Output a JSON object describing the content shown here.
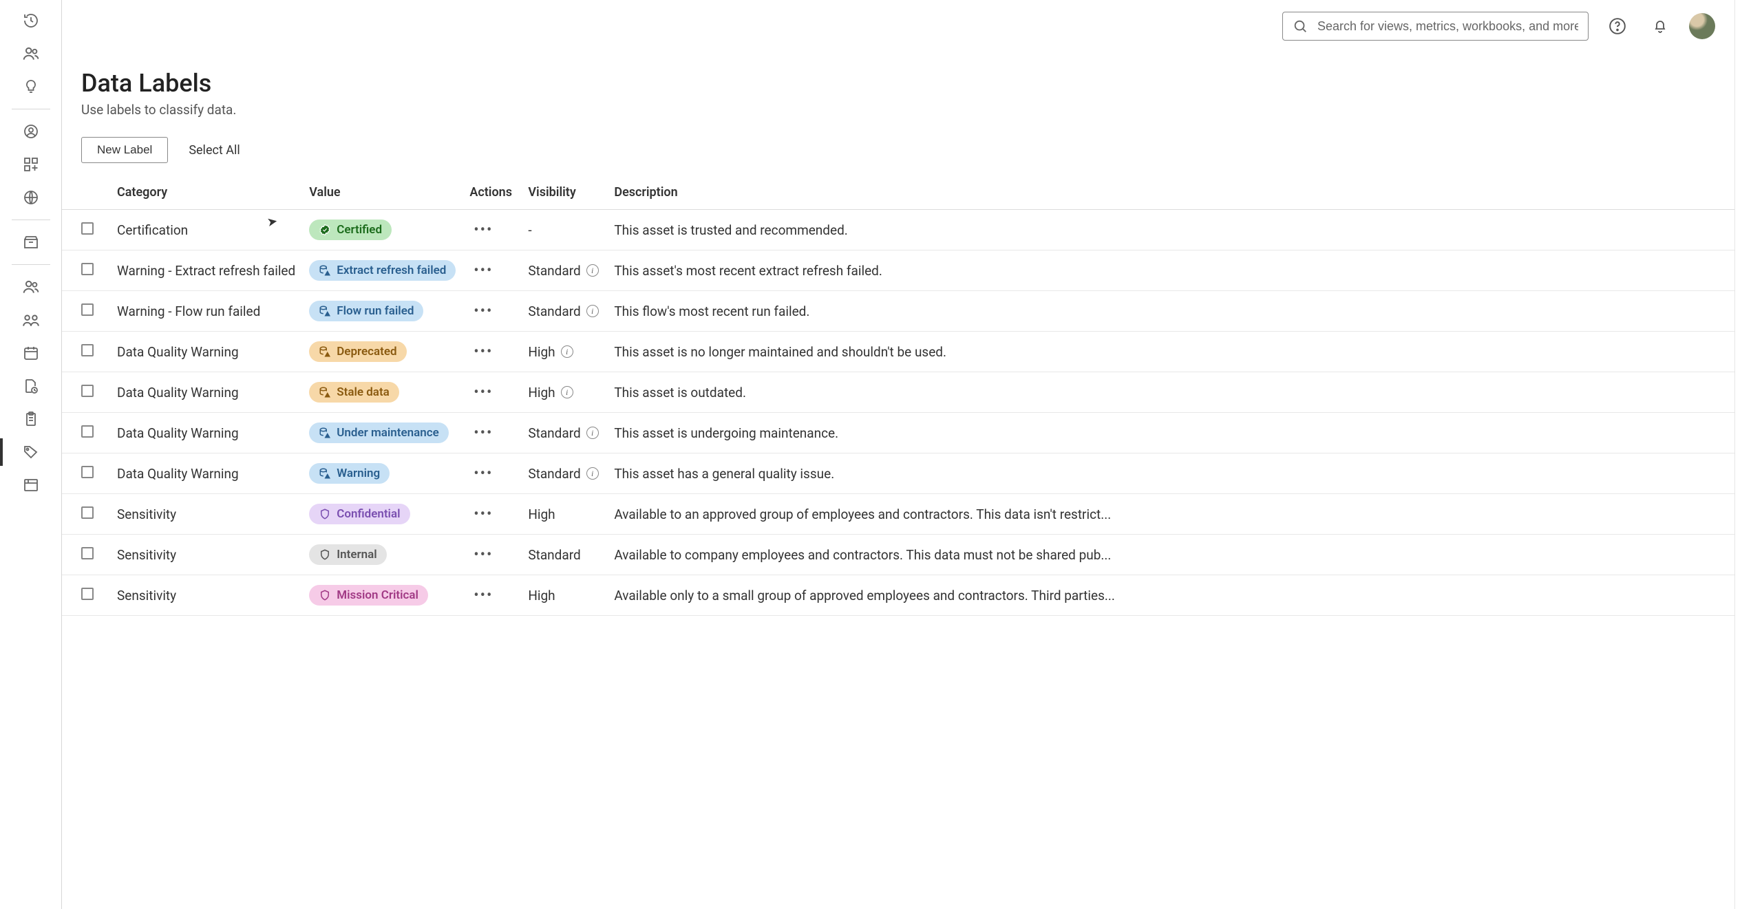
{
  "header": {
    "search_placeholder": "Search for views, metrics, workbooks, and more"
  },
  "page": {
    "title": "Data Labels",
    "subtitle": "Use labels to classify data.",
    "new_label_btn": "New Label",
    "select_all_btn": "Select All"
  },
  "columns": {
    "category": "Category",
    "value": "Value",
    "actions": "Actions",
    "visibility": "Visibility",
    "description": "Description"
  },
  "rows": [
    {
      "category": "Certification",
      "value": "Certified",
      "pill": "green",
      "icon": "cert",
      "visibility": "-",
      "info": false,
      "description": "This asset is trusted and recommended."
    },
    {
      "category": "Warning - Extract refresh failed",
      "value": "Extract refresh failed",
      "pill": "blue",
      "icon": "warn-db",
      "visibility": "Standard",
      "info": true,
      "description": "This asset's most recent extract refresh failed."
    },
    {
      "category": "Warning - Flow run failed",
      "value": "Flow run failed",
      "pill": "blue",
      "icon": "warn-db",
      "visibility": "Standard",
      "info": true,
      "description": "This flow's most recent run failed."
    },
    {
      "category": "Data Quality Warning",
      "value": "Deprecated",
      "pill": "orange",
      "icon": "warn-db",
      "visibility": "High",
      "info": true,
      "description": "This asset is no longer maintained and shouldn't be used."
    },
    {
      "category": "Data Quality Warning",
      "value": "Stale data",
      "pill": "orange",
      "icon": "warn-db",
      "visibility": "High",
      "info": true,
      "description": "This asset is outdated."
    },
    {
      "category": "Data Quality Warning",
      "value": "Under maintenance",
      "pill": "blue",
      "icon": "warn-db",
      "visibility": "Standard",
      "info": true,
      "description": "This asset is undergoing maintenance."
    },
    {
      "category": "Data Quality Warning",
      "value": "Warning",
      "pill": "blue",
      "icon": "warn-db",
      "visibility": "Standard",
      "info": true,
      "description": "This asset has a general quality issue."
    },
    {
      "category": "Sensitivity",
      "value": "Confidential",
      "pill": "purple",
      "icon": "shield",
      "visibility": "High",
      "info": false,
      "description": "Available to an approved group of employees and contractors. This data isn't restrict..."
    },
    {
      "category": "Sensitivity",
      "value": "Internal",
      "pill": "grey",
      "icon": "shield",
      "visibility": "Standard",
      "info": false,
      "description": "Available to company employees and contractors. This data must not be shared pub..."
    },
    {
      "category": "Sensitivity",
      "value": "Mission Critical",
      "pill": "pink",
      "icon": "shield",
      "visibility": "High",
      "info": false,
      "description": "Available only to a small group of approved employees and contractors. Third parties..."
    }
  ],
  "icons": {
    "dots": "•••"
  }
}
